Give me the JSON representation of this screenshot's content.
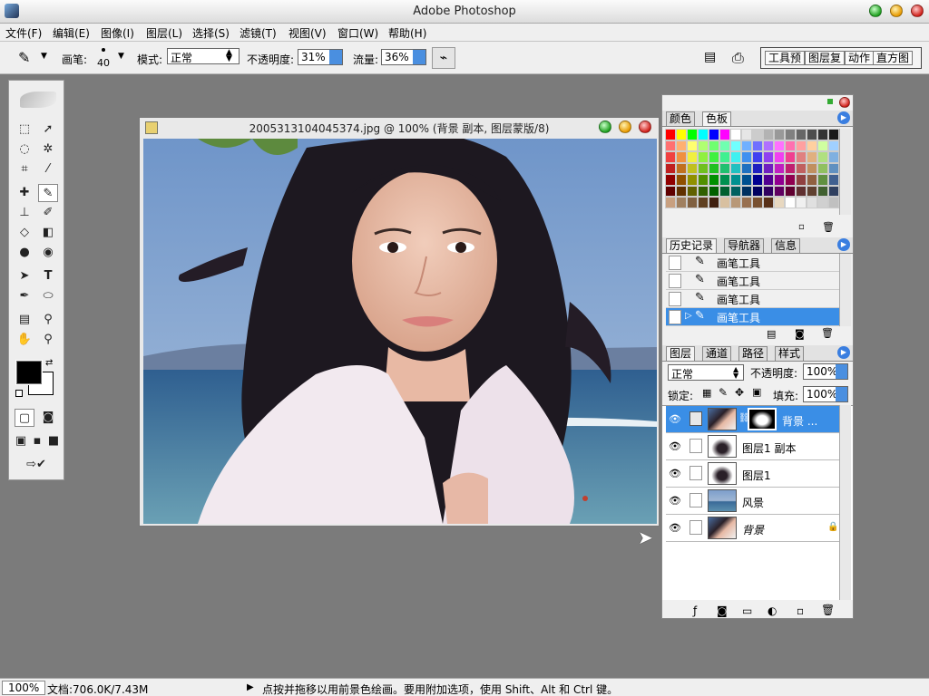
{
  "app": {
    "title": "Adobe Photoshop"
  },
  "menu": [
    "文件(F)",
    "编辑(E)",
    "图像(I)",
    "图层(L)",
    "选择(S)",
    "滤镜(T)",
    "视图(V)",
    "窗口(W)",
    "帮助(H)"
  ],
  "options": {
    "brush_label": "画笔:",
    "brush_size": "40",
    "mode_label": "模式:",
    "mode_value": "正常",
    "opacity_label": "不透明度:",
    "opacity_value": "31%",
    "flow_label": "流量:",
    "flow_value": "36%",
    "palette_tabs": [
      "工具预",
      "图层复",
      "动作",
      "直方图"
    ]
  },
  "document": {
    "title": "2005313104045374.jpg @ 100% (背景 副本, 图层蒙版/8)"
  },
  "swatches": {
    "tabs": [
      "颜色",
      "色板"
    ],
    "colors": [
      "#ff0000",
      "#ffff00",
      "#00ff00",
      "#00ffff",
      "#0000ff",
      "#ff00ff",
      "#ffffff",
      "#e6e6e6",
      "#cccccc",
      "#b3b3b3",
      "#999999",
      "#808080",
      "#666666",
      "#4d4d4d",
      "#333333",
      "#1a1a1a",
      "#ff7070",
      "#ffb070",
      "#ffff70",
      "#b0ff70",
      "#70ff70",
      "#70ffb0",
      "#70ffff",
      "#70b0ff",
      "#7070ff",
      "#b070ff",
      "#ff70ff",
      "#ff70b0",
      "#ffa0a0",
      "#ffd0a0",
      "#d0ffa0",
      "#a0d0ff",
      "#f04040",
      "#f09040",
      "#f0f040",
      "#90f040",
      "#40f040",
      "#40f090",
      "#40f0f0",
      "#4090f0",
      "#4040f0",
      "#9040f0",
      "#f040f0",
      "#f04090",
      "#e08080",
      "#e0b080",
      "#b0e080",
      "#80b0e0",
      "#c02020",
      "#c07020",
      "#c0c020",
      "#70c020",
      "#20c020",
      "#20c070",
      "#20c0c0",
      "#2070c0",
      "#2020c0",
      "#7020c0",
      "#c020c0",
      "#c02070",
      "#c06060",
      "#c09060",
      "#90c060",
      "#6090c0",
      "#900000",
      "#905000",
      "#909000",
      "#509000",
      "#009000",
      "#009050",
      "#009090",
      "#005090",
      "#000090",
      "#500090",
      "#900090",
      "#900050",
      "#904040",
      "#906040",
      "#609040",
      "#406090",
      "#600000",
      "#603000",
      "#606000",
      "#306000",
      "#006000",
      "#006030",
      "#006060",
      "#003060",
      "#000060",
      "#300060",
      "#600060",
      "#600030",
      "#603030",
      "#604030",
      "#406030",
      "#304060",
      "#c8a080",
      "#a08060",
      "#806040",
      "#604020",
      "#402010",
      "#d8c0a0",
      "#b89878",
      "#987050",
      "#785030",
      "#583018",
      "#e8d8c0",
      "#ffffff",
      "#f0f0f0",
      "#e0e0e0",
      "#d0d0d0",
      "#c0c0c0"
    ]
  },
  "history": {
    "tabs": [
      "历史记录",
      "导航器",
      "信息"
    ],
    "items": [
      "画笔工具",
      "画笔工具",
      "画笔工具",
      "画笔工具"
    ]
  },
  "layers_panel": {
    "tabs": [
      "图层",
      "通道",
      "路径",
      "样式"
    ],
    "blend_mode": "正常",
    "opacity_label": "不透明度:",
    "opacity_value": "100%",
    "lock_label": "锁定:",
    "fill_label": "填充:",
    "fill_value": "100%",
    "layers": [
      "背景 ...",
      "图层1 副本",
      "图层1",
      "风景",
      "背景"
    ]
  },
  "status": {
    "zoom": "100%",
    "doc_size": "文档:706.0K/7.43M",
    "hint": "点按并拖移以用前景色绘画。要用附加选项，使用 Shift、Alt 和 Ctrl 键。"
  }
}
